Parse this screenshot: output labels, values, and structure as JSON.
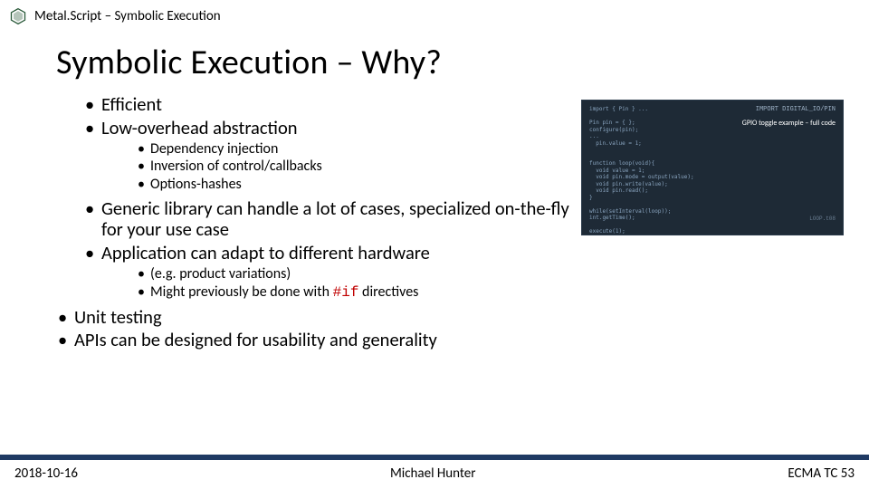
{
  "header": {
    "title": "Metal.Script – Symbolic Execution"
  },
  "slide": {
    "title": "Symbolic Execution – Why?"
  },
  "bullets": {
    "b1": "Efficient",
    "b2": "Low-overhead abstraction",
    "b2sub": {
      "s1": "Dependency injection",
      "s2": "Inversion of control/callbacks",
      "s3": "Options-hashes"
    },
    "b3": "Generic library can handle a lot of cases, specialized on-the-fly for your use case",
    "b4": "Application can adapt to different hardware",
    "b4sub": {
      "s1": "(e.g. product variations)",
      "s2_pre": "Might previously be done with ",
      "s2_code": "#if",
      "s2_post": " directives"
    },
    "b5": "Unit testing",
    "b6": "APIs can be designed for usability and generality"
  },
  "code_thumb": {
    "topright": "IMPORT DIGITAL_IO/PIN",
    "callout": "GPIO toggle example – full code",
    "tag": "LOOP.t08",
    "lines": "import { Pin } ...\n\nPin pin = { };\nconfigure(pin);\n...\n  pin.value = 1;\n\n\nfunction loop(void){\n  void value = 1;\n  void pin.mode = output(value);\n  void pin.write(value);\n  void pin.read();\n}\n\nwhile(setInterval(loop));\nint.getTime();\n\nexecute(1);"
  },
  "footer": {
    "date": "2018-10-16",
    "author": "Michael Hunter",
    "org": "ECMA TC 53"
  }
}
